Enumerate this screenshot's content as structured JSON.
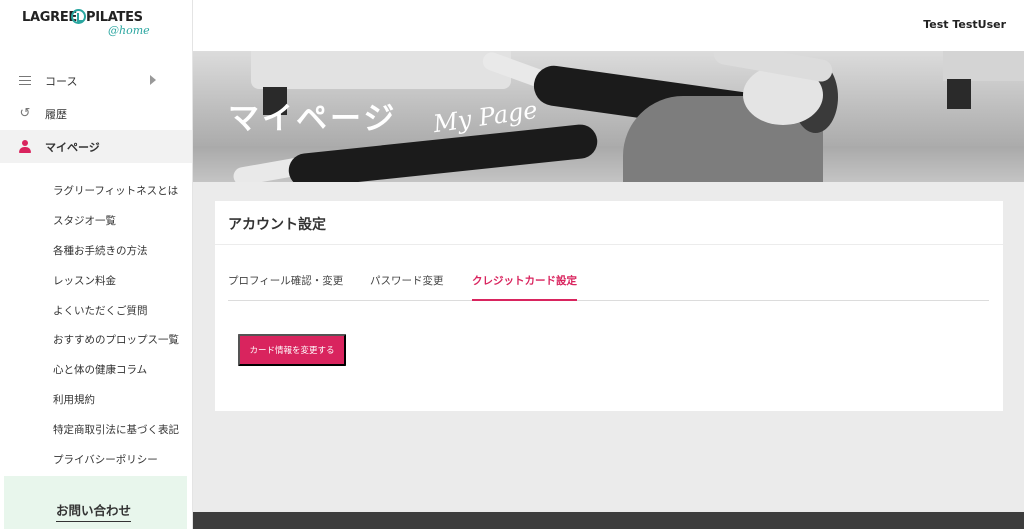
{
  "brand": {
    "left": "LAGREE",
    "right": "PILATES",
    "tag": "@home"
  },
  "header": {
    "user": "Test TestUser"
  },
  "nav": {
    "items": [
      {
        "label": "コース",
        "icon": "menu-icon"
      },
      {
        "label": "履歴",
        "icon": "history-icon"
      },
      {
        "label": "マイページ",
        "icon": "user-icon",
        "active": true
      }
    ]
  },
  "sublinks": [
    "ラグリーフィットネスとは",
    "スタジオ一覧",
    "各種お手続きの方法",
    "レッスン料金",
    "よくいただくご質問",
    "おすすめのプロップス一覧",
    "心と体の健康コラム",
    "利用規約",
    "特定商取引法に基づく表記",
    "プライバシーポリシー"
  ],
  "contact": "お問い合わせ",
  "hero": {
    "title": "マイページ",
    "subtitle": "My Page"
  },
  "card": {
    "title": "アカウント設定",
    "tabs": [
      "プロフィール確認・変更",
      "パスワード変更",
      "クレジットカード設定"
    ],
    "active_tab": 2,
    "button": "カード情報を変更する"
  },
  "colors": {
    "accent": "#d9245e",
    "brand_teal": "#2aa6a0",
    "contact_bg": "#e8f6ec"
  }
}
